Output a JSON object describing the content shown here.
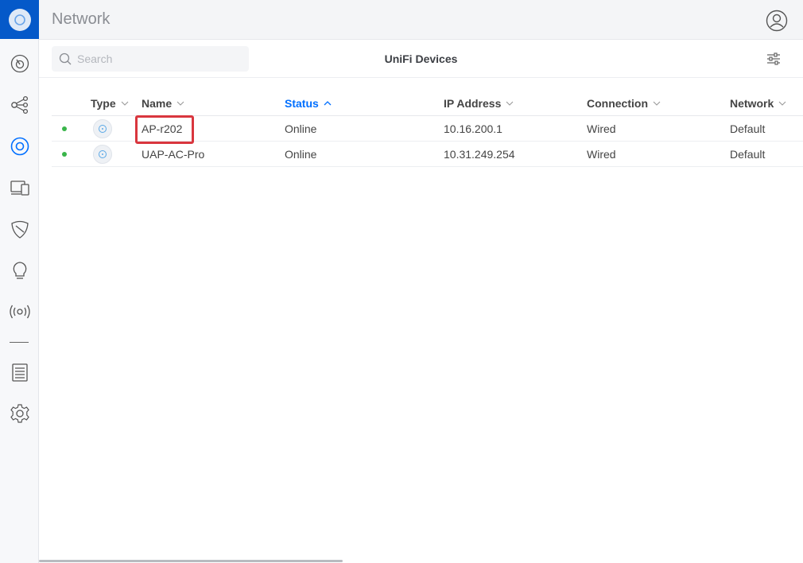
{
  "app": {
    "title": "Network"
  },
  "sidebar": {
    "items": [
      {
        "icon": "dashboard-icon"
      },
      {
        "icon": "topology-icon"
      },
      {
        "icon": "devices-icon"
      },
      {
        "icon": "clients-icon"
      },
      {
        "icon": "security-icon"
      },
      {
        "icon": "insights-icon"
      },
      {
        "icon": "wireless-icon"
      },
      {
        "icon": "logs-icon"
      },
      {
        "icon": "settings-icon"
      }
    ]
  },
  "toolbar": {
    "search_placeholder": "Search",
    "title": "UniFi Devices"
  },
  "table": {
    "columns": {
      "type": "Type",
      "name": "Name",
      "status": "Status",
      "ip": "IP Address",
      "connection": "Connection",
      "network": "Network"
    },
    "sort_column": "Status",
    "rows": [
      {
        "name": "AP-r202",
        "status": "Online",
        "ip": "10.16.200.1",
        "connection": "Wired",
        "network": "Default"
      },
      {
        "name": "UAP-AC-Pro",
        "status": "Online",
        "ip": "10.31.249.254",
        "connection": "Wired",
        "network": "Default"
      }
    ]
  },
  "colors": {
    "accent": "#006fff",
    "logo_bg": "#0559c9",
    "online": "#39b54a",
    "highlight": "#d9363e"
  }
}
